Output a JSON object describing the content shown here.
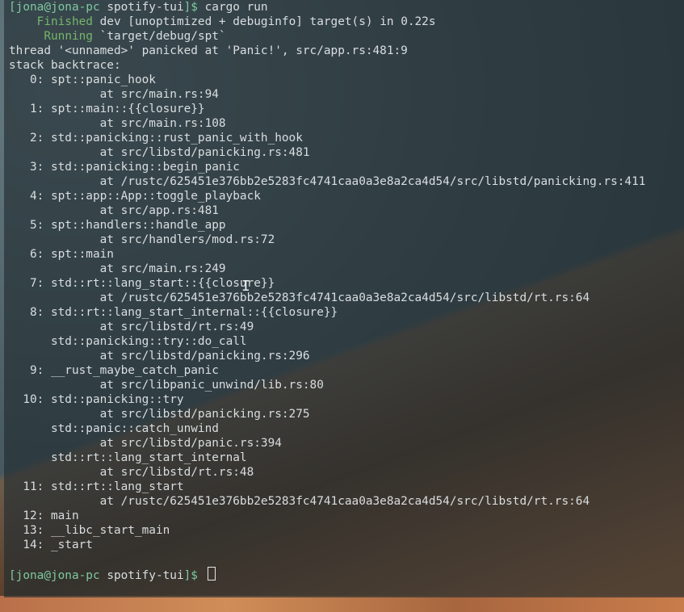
{
  "session": {
    "prompt_user": "[jona@jona-pc",
    "cwd": "spotify-tui",
    "prompt_end": "]$",
    "command": "cargo run"
  },
  "build": {
    "finished_label": "Finished",
    "finished_text": "dev [unoptimized + debuginfo] target(s) in 0.22s",
    "running_label": "Running",
    "running_text": "`target/debug/spt`"
  },
  "panic": {
    "message": "thread '<unnamed>' panicked at 'Panic!', src/app.rs:481:9",
    "header": "stack backtrace:"
  },
  "backtrace": [
    {
      "text": "   0: spt::panic_hook"
    },
    {
      "text": "             at src/main.rs:94"
    },
    {
      "text": "   1: spt::main::{{closure}}"
    },
    {
      "text": "             at src/main.rs:108"
    },
    {
      "text": "   2: std::panicking::rust_panic_with_hook"
    },
    {
      "text": "             at src/libstd/panicking.rs:481"
    },
    {
      "text": "   3: std::panicking::begin_panic"
    },
    {
      "text": "             at /rustc/625451e376bb2e5283fc4741caa0a3e8a2ca4d54/src/libstd/panicking.rs:411"
    },
    {
      "text": "   4: spt::app::App::toggle_playback"
    },
    {
      "text": "             at src/app.rs:481"
    },
    {
      "text": "   5: spt::handlers::handle_app"
    },
    {
      "text": "             at src/handlers/mod.rs:72"
    },
    {
      "text": "   6: spt::main"
    },
    {
      "text": "             at src/main.rs:249"
    },
    {
      "text": "   7: std::rt::lang_start::{{closure}}"
    },
    {
      "text": "             at /rustc/625451e376bb2e5283fc4741caa0a3e8a2ca4d54/src/libstd/rt.rs:64"
    },
    {
      "text": "   8: std::rt::lang_start_internal::{{closure}}"
    },
    {
      "text": "             at src/libstd/rt.rs:49"
    },
    {
      "text": "      std::panicking::try::do_call"
    },
    {
      "text": "             at src/libstd/panicking.rs:296"
    },
    {
      "text": "   9: __rust_maybe_catch_panic"
    },
    {
      "text": "             at src/libpanic_unwind/lib.rs:80"
    },
    {
      "text": "  10: std::panicking::try"
    },
    {
      "text": "             at src/libstd/panicking.rs:275"
    },
    {
      "text": "      std::panic::catch_unwind"
    },
    {
      "text": "             at src/libstd/panic.rs:394"
    },
    {
      "text": "      std::rt::lang_start_internal"
    },
    {
      "text": "             at src/libstd/rt.rs:48"
    },
    {
      "text": "  11: std::rt::lang_start"
    },
    {
      "text": "             at /rustc/625451e376bb2e5283fc4741caa0a3e8a2ca4d54/src/libstd/rt.rs:64"
    },
    {
      "text": "  12: main"
    },
    {
      "text": "  13: __libc_start_main"
    },
    {
      "text": "  14: _start"
    }
  ],
  "colors": {
    "prompt": "#7ec8a0",
    "cargo_status": "#76b56a",
    "text": "#d9dde0"
  },
  "icons": {
    "cursor": "block-cursor-icon",
    "mouse": "i-beam-cursor-icon"
  }
}
